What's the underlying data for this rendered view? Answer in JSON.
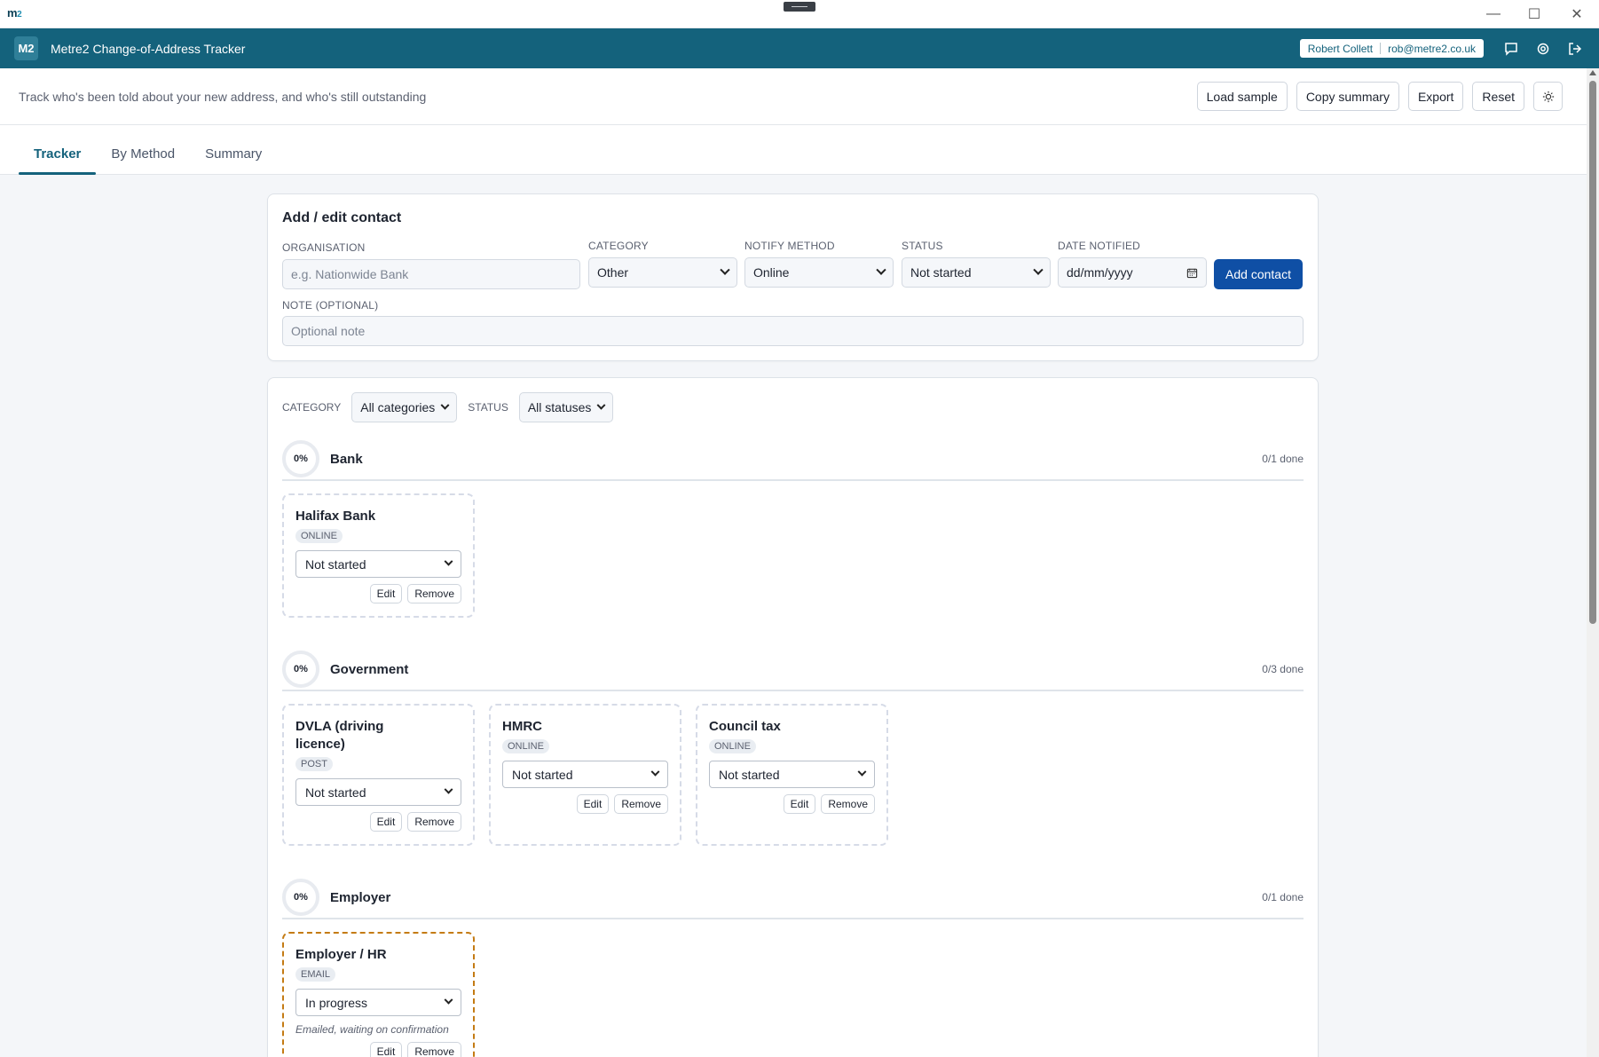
{
  "os": {
    "logo_m": "m",
    "logo_2": "2"
  },
  "header": {
    "logo": "M2",
    "title": "Metre2 Change-of-Address Tracker",
    "user_name": "Robert Collett",
    "user_email": "rob@metre2.co.uk"
  },
  "toolbar": {
    "tagline": "Track who's been told about your new address, and who's still outstanding",
    "load_sample": "Load sample",
    "copy_summary": "Copy summary",
    "export": "Export",
    "reset": "Reset"
  },
  "tabs": [
    {
      "label": "Tracker",
      "active": true
    },
    {
      "label": "By Method",
      "active": false
    },
    {
      "label": "Summary",
      "active": false
    }
  ],
  "form": {
    "title": "Add / edit contact",
    "organisation_label": "ORGANISATION",
    "organisation_placeholder": "e.g. Nationwide Bank",
    "category_label": "CATEGORY",
    "category_value": "Other",
    "method_label": "NOTIFY METHOD",
    "method_value": "Online",
    "status_label": "STATUS",
    "status_value": "Not started",
    "date_label": "DATE NOTIFIED",
    "date_placeholder": "dd/mm/yyyy",
    "add_button": "Add contact",
    "note_label": "NOTE (OPTIONAL)",
    "note_placeholder": "Optional note"
  },
  "filters": {
    "category_label": "CATEGORY",
    "category_value": "All categories",
    "status_label": "STATUS",
    "status_value": "All statuses"
  },
  "groups": [
    {
      "name": "Bank",
      "percent": "0%",
      "count": "0/1 done",
      "items": [
        {
          "name": "Halifax Bank",
          "method": "ONLINE",
          "status": "Not started",
          "edit": "Edit",
          "remove": "Remove"
        }
      ]
    },
    {
      "name": "Government",
      "percent": "0%",
      "count": "0/3 done",
      "items": [
        {
          "name": "DVLA (driving licence)",
          "method": "POST",
          "status": "Not started",
          "edit": "Edit",
          "remove": "Remove"
        },
        {
          "name": "HMRC",
          "method": "ONLINE",
          "status": "Not started",
          "edit": "Edit",
          "remove": "Remove"
        },
        {
          "name": "Council tax",
          "method": "ONLINE",
          "status": "Not started",
          "edit": "Edit",
          "remove": "Remove"
        }
      ]
    },
    {
      "name": "Employer",
      "percent": "0%",
      "count": "0/1 done",
      "items": [
        {
          "name": "Employer / HR",
          "method": "EMAIL",
          "status": "In progress",
          "note": "Emailed, waiting on confirmation",
          "edit": "Edit",
          "remove": "Remove"
        }
      ]
    }
  ],
  "colors": {
    "brand": "#14627c",
    "primary_button": "#0f4fa5",
    "in_progress_border": "#c47b14"
  }
}
